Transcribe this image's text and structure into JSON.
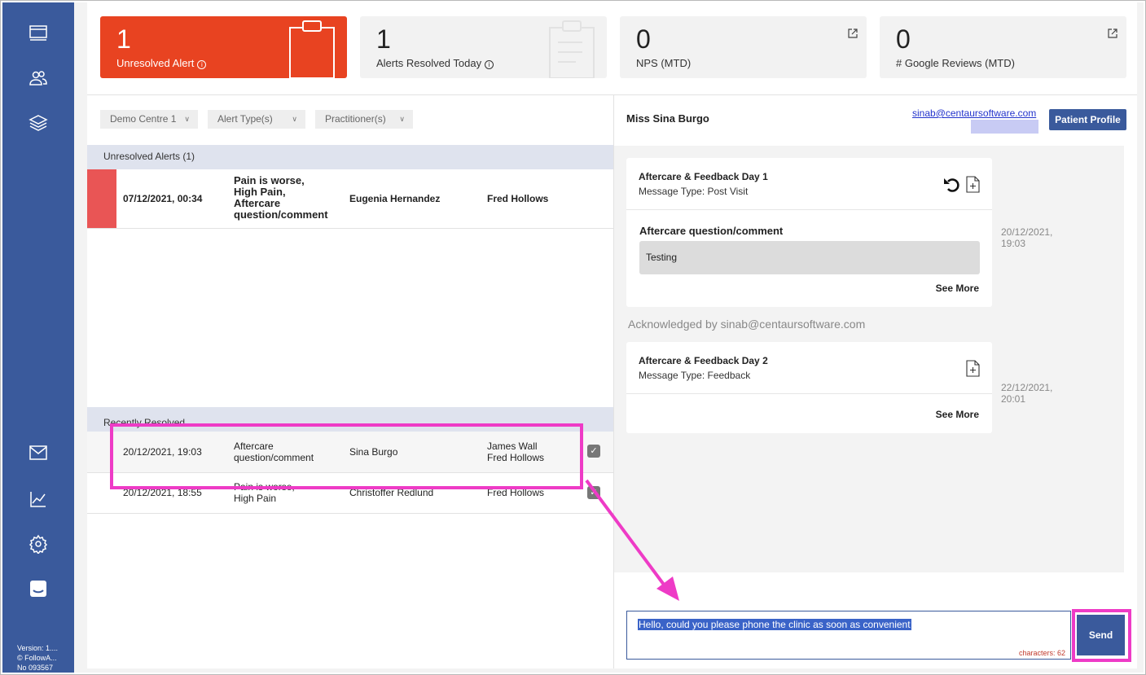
{
  "sidebar": {
    "version_lines": [
      "Version: 1....",
      "© FollowA...",
      "No 093567"
    ]
  },
  "stats": [
    {
      "value": "1",
      "label": "Unresolved Alert",
      "info": "i"
    },
    {
      "value": "1",
      "label": "Alerts Resolved Today",
      "info": "i"
    },
    {
      "value": "0",
      "label": "NPS (MTD)"
    },
    {
      "value": "0",
      "label": "# Google Reviews (MTD)"
    }
  ],
  "filters": [
    {
      "label": "Demo Centre 1"
    },
    {
      "label": "Alert Type(s)"
    },
    {
      "label": "Practitioner(s)"
    }
  ],
  "unresolved": {
    "header": "Unresolved Alerts (1)",
    "rows": [
      {
        "date": "07/12/2021, 00:34",
        "type_lines": [
          "Pain is worse,",
          "High Pain,",
          "Aftercare",
          "question/comment"
        ],
        "patient": "Eugenia Hernandez",
        "practitioner": "Fred Hollows"
      }
    ]
  },
  "resolved": {
    "header": "Recently Resolved",
    "rows": [
      {
        "date": "20/12/2021, 19:03",
        "type_lines": [
          "Aftercare",
          "question/comment"
        ],
        "patient": "Sina Burgo",
        "practitioner_lines": [
          "James Wall",
          "Fred Hollows"
        ]
      },
      {
        "date": "20/12/2021, 18:55",
        "type_lines": [
          "Pain is worse,",
          "High Pain"
        ],
        "patient": "Christoffer Redlund",
        "practitioner_lines": [
          "Fred Hollows"
        ]
      }
    ]
  },
  "patient": {
    "name": "Miss Sina Burgo",
    "email": "sinab@centaursoftware.com",
    "profile_button": "Patient Profile"
  },
  "messages": [
    {
      "title": "Aftercare & Feedback Day 1",
      "type": "Message Type: Post Visit",
      "question": "Aftercare question/comment",
      "answer": "Testing",
      "see_more": "See More",
      "stamp_lines": [
        "20/12/2021,",
        "19:03"
      ]
    },
    {
      "title": "Aftercare & Feedback Day 2",
      "type": "Message Type: Feedback",
      "see_more": "See More",
      "stamp_lines": [
        "22/12/2021,",
        "20:01"
      ]
    }
  ],
  "acknowledged": "Acknowledged by sinab@centaursoftware.com",
  "composer": {
    "text": "Hello, could you please phone the clinic as soon as convenient",
    "char_count": "characters: 62",
    "send_label": "Send"
  },
  "colors": {
    "sidebar": "#3a5a9c",
    "alert_red": "#e84321",
    "annotation": "#ee3bc6",
    "row_flag": "#e95555"
  }
}
